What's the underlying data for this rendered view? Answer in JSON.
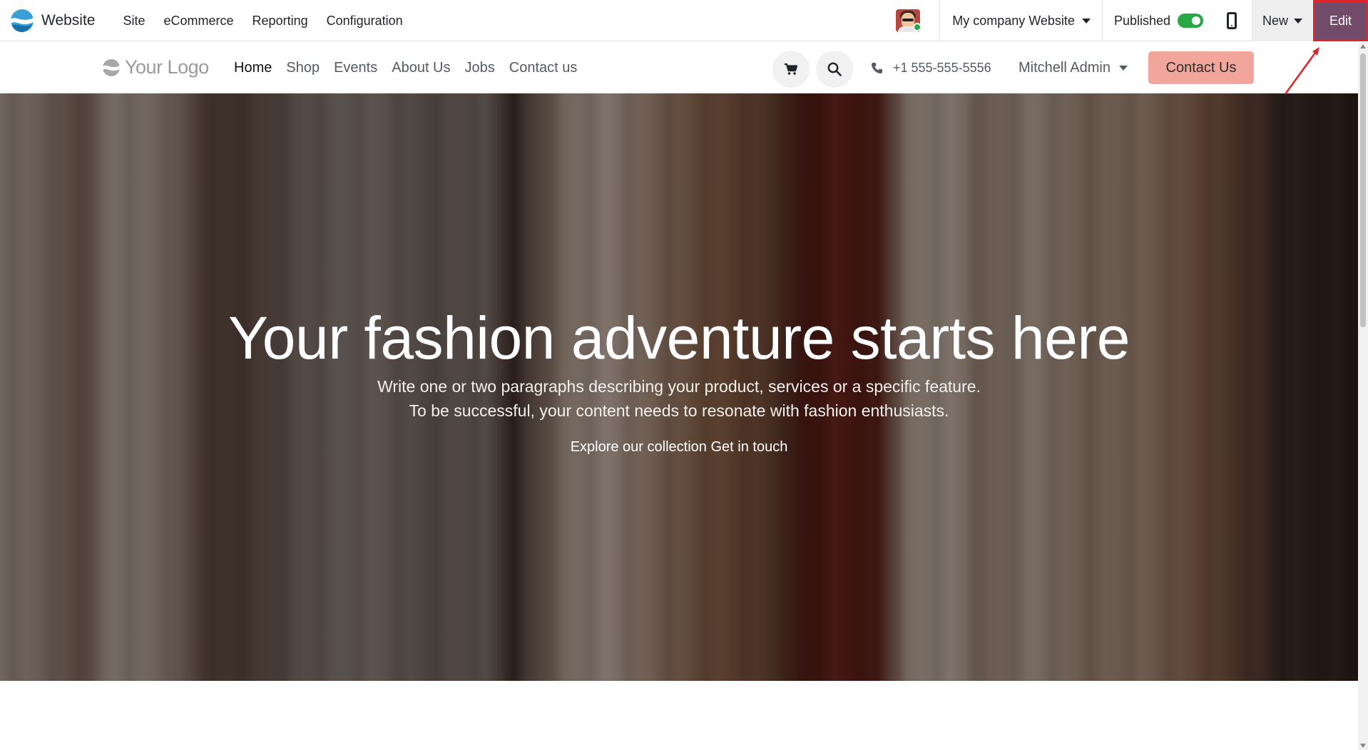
{
  "admin_bar": {
    "app_name": "Website",
    "menu": [
      "Site",
      "eCommerce",
      "Reporting",
      "Configuration"
    ],
    "website_selector": "My company Website",
    "published_label": "Published",
    "published": true,
    "new_label": "New",
    "edit_label": "Edit"
  },
  "site_header": {
    "logo_text": "Your Logo",
    "nav": [
      "Home",
      "Shop",
      "Events",
      "About Us",
      "Jobs",
      "Contact us"
    ],
    "active_nav": "Home",
    "phone": "+1 555-555-5556",
    "user": "Mitchell Admin",
    "cta_label": "Contact Us"
  },
  "hero": {
    "title": "Your fashion adventure starts here",
    "paragraph_line1": "Write one or two paragraphs describing your product, services or a specific feature.",
    "paragraph_line2": "To be successful, your content needs to resonate with fashion enthusiasts.",
    "link_primary": "Explore our collection",
    "link_secondary": "Get in touch"
  },
  "colors": {
    "odoo_purple": "#714b67",
    "cta_salmon": "#f2a59b",
    "published_green": "#28a745",
    "annotation_red": "#e0222a"
  },
  "icons": [
    "odoo-website-icon",
    "mobile-preview-icon",
    "cart-icon",
    "search-icon",
    "phone-icon",
    "logo-icon"
  ]
}
